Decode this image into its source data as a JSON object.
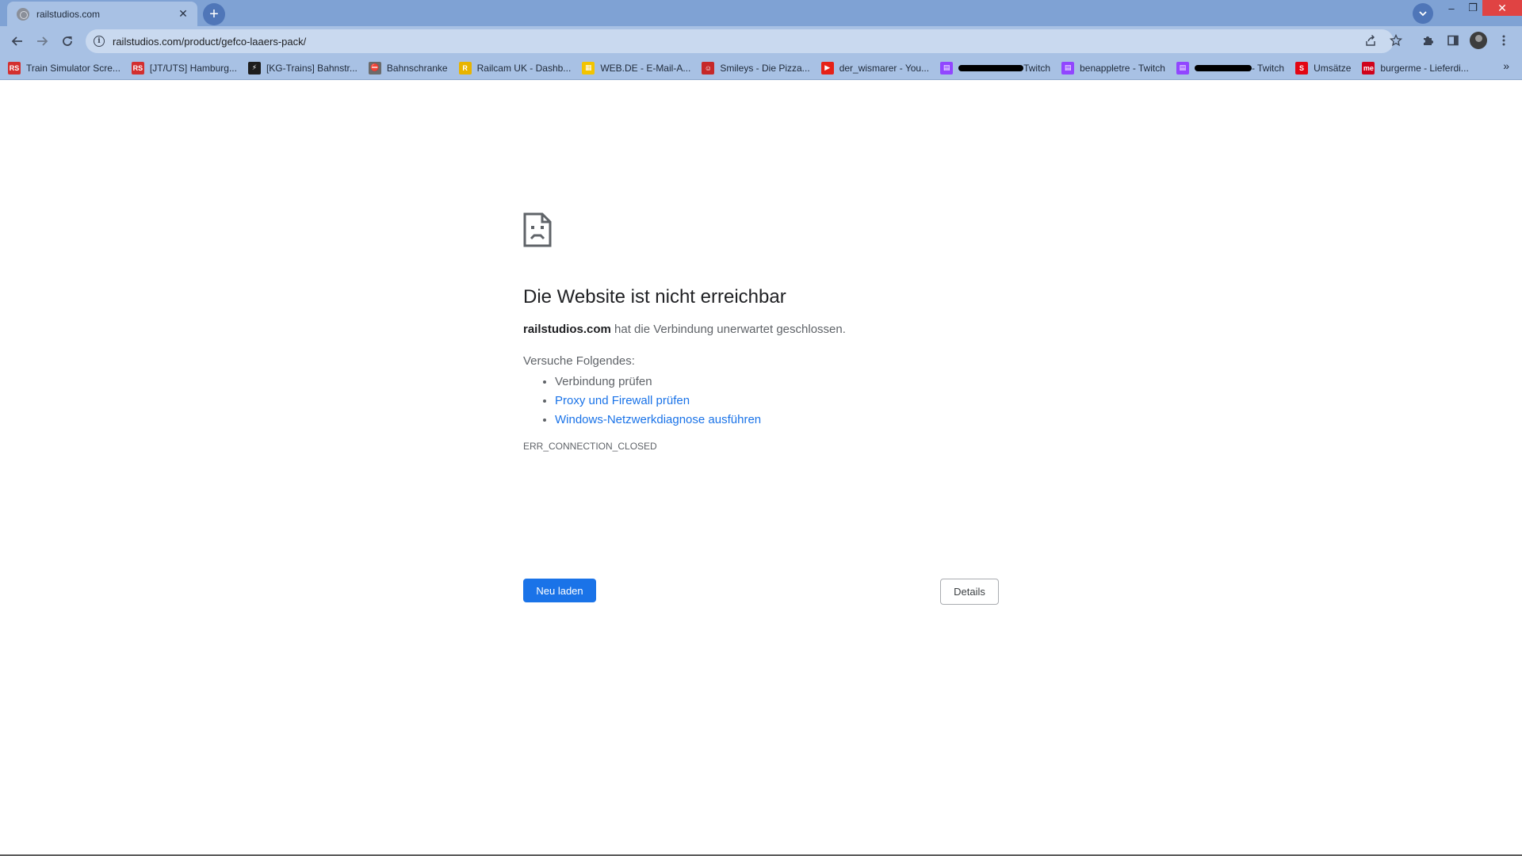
{
  "browser": {
    "tab": {
      "title": "railstudios.com",
      "close_glyph": "✕",
      "favicon": "globe-icon"
    },
    "new_tab_glyph": "+",
    "window": {
      "minimize_glyph": "–",
      "maximize_glyph": "❐",
      "close_glyph": "✕"
    },
    "address_bar": {
      "url": "railstudios.com/product/gefco-laaers-pack/",
      "info_glyph": "i"
    },
    "bookmarks": [
      {
        "label": "Train Simulator Scre...",
        "icon": "rs-icon",
        "icon_text": "RS",
        "icon_color": "#d32f2f"
      },
      {
        "label": "[JT/UTS] Hamburg...",
        "icon": "rs-icon",
        "icon_text": "RS",
        "icon_color": "#d32f2f"
      },
      {
        "label": "[KG-Trains] Bahnstr...",
        "icon": "kg-icon",
        "icon_text": "⚡",
        "icon_color": "#1d1d1d"
      },
      {
        "label": "Bahnschranke",
        "icon": "barrier-icon",
        "icon_text": "⛔",
        "icon_color": "#6b6b6b"
      },
      {
        "label": "Railcam UK - Dashb...",
        "icon": "railcam-icon",
        "icon_text": "R",
        "icon_color": "#e8b400"
      },
      {
        "label": "WEB.DE - E-Mail-A...",
        "icon": "webde-icon",
        "icon_text": "▦",
        "icon_color": "#f3c400"
      },
      {
        "label": "Smileys - Die Pizza...",
        "icon": "smileys-icon",
        "icon_text": "☺",
        "icon_color": "#c62828"
      },
      {
        "label": "der_wismarer - You...",
        "icon": "youtube-icon",
        "icon_text": "▶",
        "icon_color": "#e62117"
      },
      {
        "label": "Twitch",
        "icon": "twitch-icon",
        "icon_text": "▤",
        "icon_color": "#9146ff",
        "redacted_width": 82
      },
      {
        "label": "benappletre - Twitch",
        "icon": "twitch-icon",
        "icon_text": "▤",
        "icon_color": "#9146ff"
      },
      {
        "label": " - Twitch",
        "icon": "twitch-icon",
        "icon_text": "▤",
        "icon_color": "#9146ff",
        "redacted_width": 72
      },
      {
        "label": "Umsätze",
        "icon": "sparkasse-icon",
        "icon_text": "S",
        "icon_color": "#e30613"
      },
      {
        "label": "burgerme - Lieferdi...",
        "icon": "burgerme-icon",
        "icon_text": "me",
        "icon_color": "#d0021b"
      }
    ],
    "bookmarks_more_glyph": "»"
  },
  "page": {
    "title": "Die Website ist nicht erreichbar",
    "description_domain": "railstudios.com",
    "description_rest": " hat die Verbindung unerwartet geschlossen.",
    "try_heading": "Versuche Folgendes:",
    "suggestions": [
      {
        "text": "Verbindung prüfen",
        "link": false
      },
      {
        "text": "Proxy und Firewall prüfen",
        "link": true
      },
      {
        "text": "Windows-Netzwerkdiagnose ausführen",
        "link": true
      }
    ],
    "error_code": "ERR_CONNECTION_CLOSED",
    "reload_button": "Neu laden",
    "details_button": "Details"
  },
  "colors": {
    "accent": "#1a73e8",
    "frame": "#7fa2d4",
    "toolbar": "#a8c1e4"
  }
}
